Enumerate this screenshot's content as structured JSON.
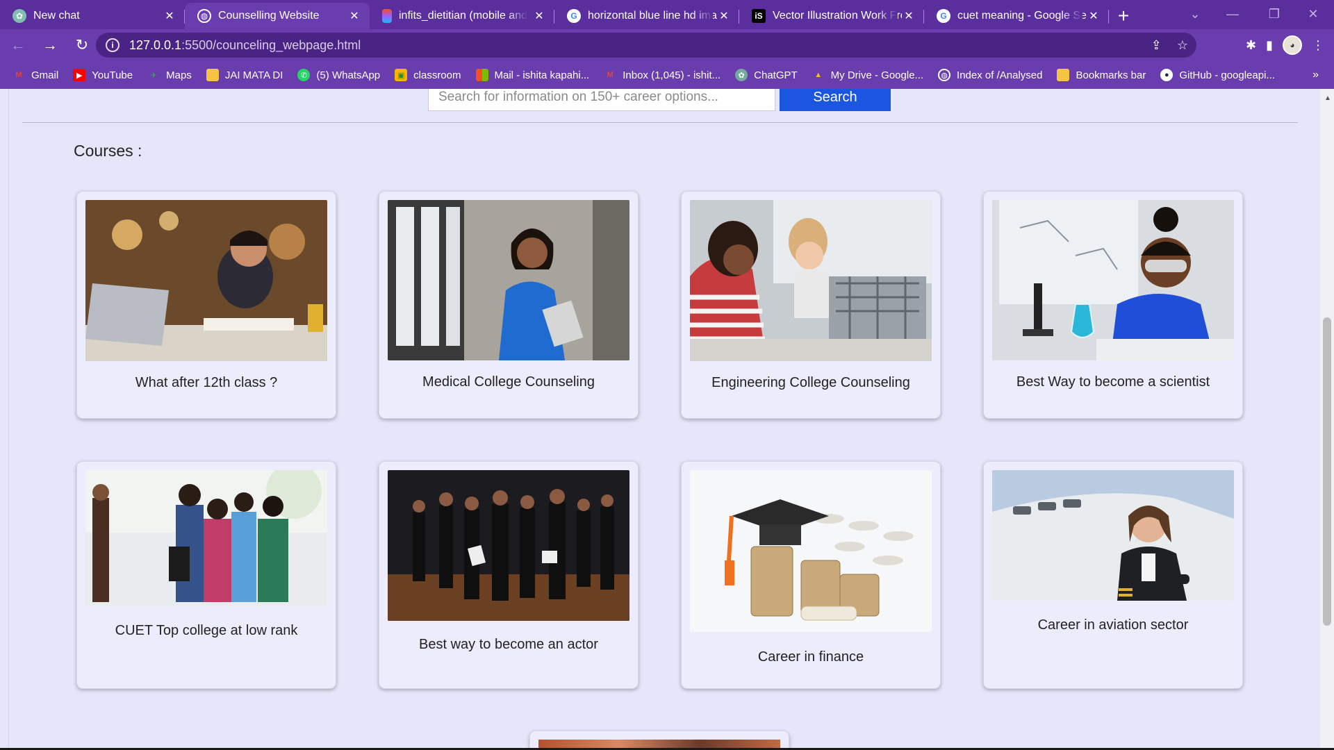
{
  "browser": {
    "tabs": [
      {
        "title": "New chat",
        "icon": "chatgpt-icon"
      },
      {
        "title": "Counselling Website",
        "icon": "globe-icon",
        "active": true
      },
      {
        "title": "infits_dietitian (mobile and",
        "icon": "figma-icon"
      },
      {
        "title": "horizontal blue line hd imag",
        "icon": "google-icon"
      },
      {
        "title": "Vector Illustration Work Fro",
        "icon": "istock-icon"
      },
      {
        "title": "cuet meaning - Google Sear",
        "icon": "google-icon"
      }
    ],
    "url_host": "127.0.0.1",
    "url_path": ":5500/counceling_webpage.html",
    "bookmarks": [
      {
        "label": "Gmail",
        "icon": "gmail-icon",
        "color": "#ea4335"
      },
      {
        "label": "YouTube",
        "icon": "youtube-icon",
        "color": "#ff0000"
      },
      {
        "label": "Maps",
        "icon": "maps-icon",
        "color": "#34a853"
      },
      {
        "label": "JAI MATA DI",
        "icon": "folder-icon",
        "color": "#f6c445"
      },
      {
        "label": "(5) WhatsApp",
        "icon": "whatsapp-icon",
        "color": "#25d366"
      },
      {
        "label": "classroom",
        "icon": "classroom-icon",
        "color": "#f4b400"
      },
      {
        "label": "Mail - ishita kapahi...",
        "icon": "microsoft-icon",
        "color": "#f25022"
      },
      {
        "label": "Inbox (1,045) - ishit...",
        "icon": "gmail-icon",
        "color": "#ea4335"
      },
      {
        "label": "ChatGPT",
        "icon": "chatgpt-icon",
        "color": "#74aa9c"
      },
      {
        "label": "My Drive - Google...",
        "icon": "drive-icon",
        "color": "#fbbc04"
      },
      {
        "label": "Index of /Analysed",
        "icon": "globe-icon",
        "color": "#ffffff"
      },
      {
        "label": "Bookmarks bar",
        "icon": "folder-icon",
        "color": "#f6c445"
      },
      {
        "label": "GitHub - googleapi...",
        "icon": "github-icon",
        "color": "#ffffff"
      }
    ]
  },
  "page": {
    "search_placeholder": "Search for information on 150+ career options...",
    "search_button": "Search",
    "section_title": "Courses :",
    "cards": [
      {
        "caption": "What after 12th class ?",
        "image": "student-laptop-image"
      },
      {
        "caption": "Medical College Counseling",
        "image": "doctor-scrubs-image"
      },
      {
        "caption": "Engineering College Counseling",
        "image": "robotics-lab-image"
      },
      {
        "caption": "Best Way to become a scientist",
        "image": "scientist-flask-image"
      },
      {
        "caption": "CUET Top college at low rank",
        "image": "students-campus-image"
      },
      {
        "caption": "Best way to become an actor",
        "image": "acting-class-image"
      },
      {
        "caption": "Career in finance",
        "image": "coins-graduation-cap-image"
      },
      {
        "caption": "Career in aviation sector",
        "image": "pilot-airplane-image"
      }
    ]
  },
  "colors": {
    "chrome": "#6a3dae",
    "page_bg": "#e6e6fb",
    "search_button": "#1a56e0"
  }
}
